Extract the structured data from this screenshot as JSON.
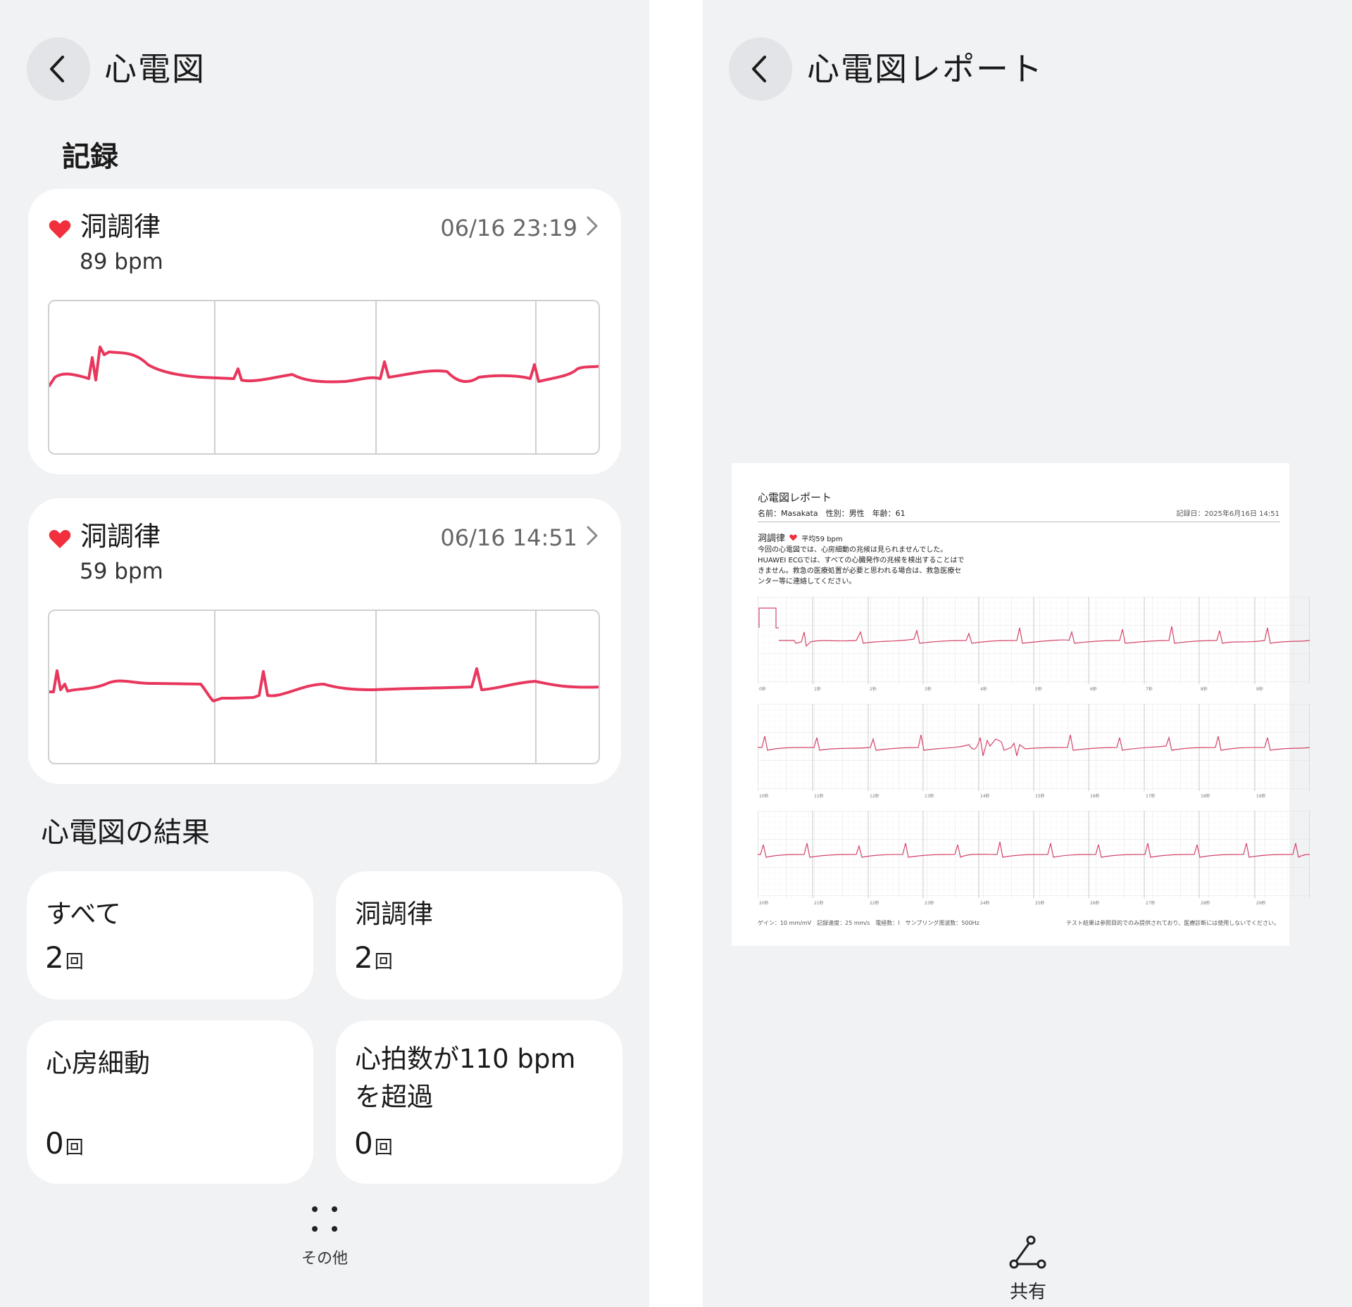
{
  "left": {
    "title": "心電図",
    "records_heading": "記録",
    "records": [
      {
        "type": "洞調律",
        "date": "06/16 23:19",
        "bpm": "89 bpm"
      },
      {
        "type": "洞調律",
        "date": "06/16 14:51",
        "bpm": "59 bpm"
      }
    ],
    "results_heading": "心電図の結果",
    "results": [
      {
        "label": "すべて",
        "count": "2",
        "unit": "回"
      },
      {
        "label": "洞調律",
        "count": "2",
        "unit": "回"
      },
      {
        "label": "心房細動",
        "count": "0",
        "unit": "回"
      },
      {
        "label": "心拍数が110 bpmを超過",
        "count": "0",
        "unit": "回"
      }
    ],
    "more_label": "その他"
  },
  "right": {
    "title": "心電図レポート",
    "share_label": "共有",
    "report": {
      "title": "心電図レポート",
      "info": "名前：Masakata　性別：男性　年齢：61",
      "record_date": "記録日：2025年6月16日 14:51",
      "rhythm": "洞調律",
      "avg": "平均59 bpm",
      "desc": [
        "今回の心電図では、心房細動の兆候は見られませんでした。",
        "HUAWEI ECGでは、すべての心臓発作の兆候を検出することはで",
        "きません。救急の医療処置が必要と思われる場合は、救急医療セ",
        "ンター等に連絡してください。"
      ],
      "strip1_ticks": [
        "0秒",
        "1秒",
        "2秒",
        "3秒",
        "4秒",
        "5秒",
        "6秒",
        "7秒",
        "8秒",
        "9秒"
      ],
      "strip2_ticks": [
        "10秒",
        "11秒",
        "12秒",
        "13秒",
        "14秒",
        "15秒",
        "16秒",
        "17秒",
        "18秒",
        "19秒"
      ],
      "strip3_ticks": [
        "20秒",
        "21秒",
        "22秒",
        "23秒",
        "24秒",
        "25秒",
        "26秒",
        "27秒",
        "28秒",
        "29秒"
      ],
      "footer_left": "ゲイン：10 mm/mV　記録速度：25 mm/s　電極数：I　サンプリング周波数：500Hz",
      "footer_right": "テスト結果は参照目的でのみ提供されており、医療診断には使用しないでください。"
    }
  },
  "colors": {
    "accent": "#e8375d",
    "heart": "#f2303d",
    "panel": "#f1f2f4",
    "card": "#ffffff"
  }
}
